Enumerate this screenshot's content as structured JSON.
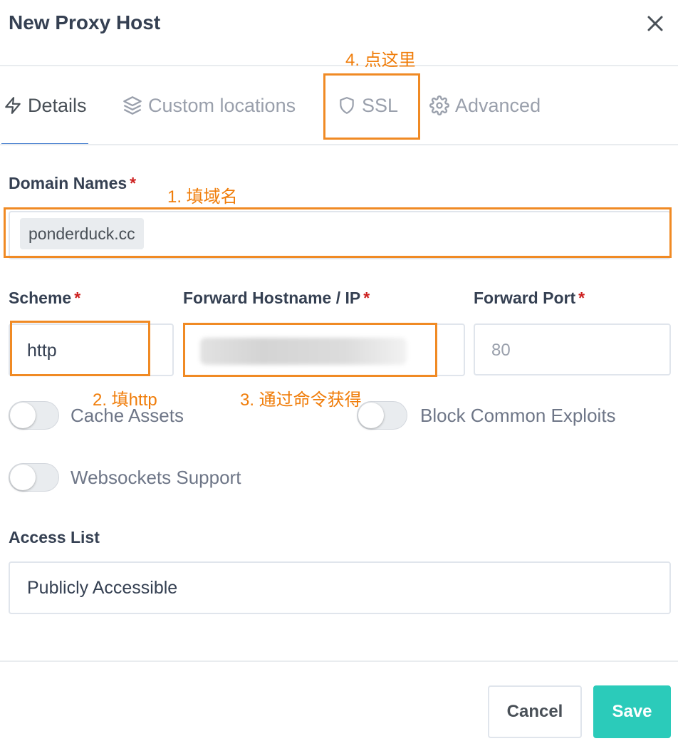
{
  "modal": {
    "title": "New Proxy Host"
  },
  "tabs": [
    {
      "label": "Details",
      "icon": "lightning-icon",
      "active": true
    },
    {
      "label": "Custom locations",
      "icon": "layers-icon",
      "active": false
    },
    {
      "label": "SSL",
      "icon": "shield-icon",
      "active": false
    },
    {
      "label": "Advanced",
      "icon": "gear-icon",
      "active": false
    }
  ],
  "form": {
    "domain_names": {
      "label": "Domain Names",
      "required": "*",
      "tags": [
        "ponderduck.cc"
      ]
    },
    "scheme": {
      "label": "Scheme",
      "required": "*",
      "value": "http"
    },
    "forward_host": {
      "label": "Forward Hostname / IP",
      "required": "*",
      "value": ""
    },
    "forward_port": {
      "label": "Forward Port",
      "required": "*",
      "placeholder": "80"
    },
    "toggles": [
      {
        "label": "Cache Assets",
        "checked": false
      },
      {
        "label": "Block Common Exploits",
        "checked": false
      },
      {
        "label": "Websockets Support",
        "checked": false
      }
    ],
    "access_list": {
      "label": "Access List",
      "value": "Publicly Accessible"
    }
  },
  "annotations": [
    "1. 填域名",
    "2. 填http",
    "3. 通过命令获得",
    "4. 点这里"
  ],
  "footer": {
    "cancel_label": "Cancel",
    "save_label": "Save"
  },
  "colors": {
    "accent_tab": "#467fcf",
    "save_button": "#2bcbba",
    "required": "#cd201f",
    "annotation": "#f08a24"
  }
}
